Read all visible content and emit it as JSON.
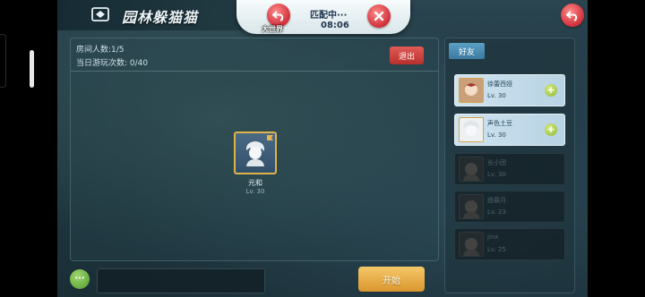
{
  "header": {
    "mode_title": "园林躲猫猫",
    "world_label": "大世界",
    "match_status": "匹配中···",
    "match_timer": "08:06"
  },
  "room": {
    "players_line": "房间人数:1/5",
    "plays_line": "当日游玩次数: 0/40",
    "exit_label": "退出",
    "members": [
      {
        "name": "元和",
        "level": "Lv. 30"
      }
    ]
  },
  "bottom": {
    "chat_icon": "···",
    "start_label": "开始"
  },
  "friends": {
    "tab_label": "好友",
    "list": [
      {
        "name": "徐蕾西娅",
        "level": "Lv. 30",
        "status": "online"
      },
      {
        "name": "声色土豆",
        "level": "Lv. 30",
        "status": "online"
      },
      {
        "name": "长小团",
        "level": "Lv. 30",
        "status": "offline"
      },
      {
        "name": "曲慕月",
        "level": "Lv. 23",
        "status": "offline"
      },
      {
        "name": "jinx",
        "level": "Lv. 25",
        "status": "offline"
      }
    ]
  },
  "colors": {
    "accent_red": "#d0303a",
    "start_orange": "#e6a940",
    "friend_tab_blue": "#4a8db5"
  }
}
